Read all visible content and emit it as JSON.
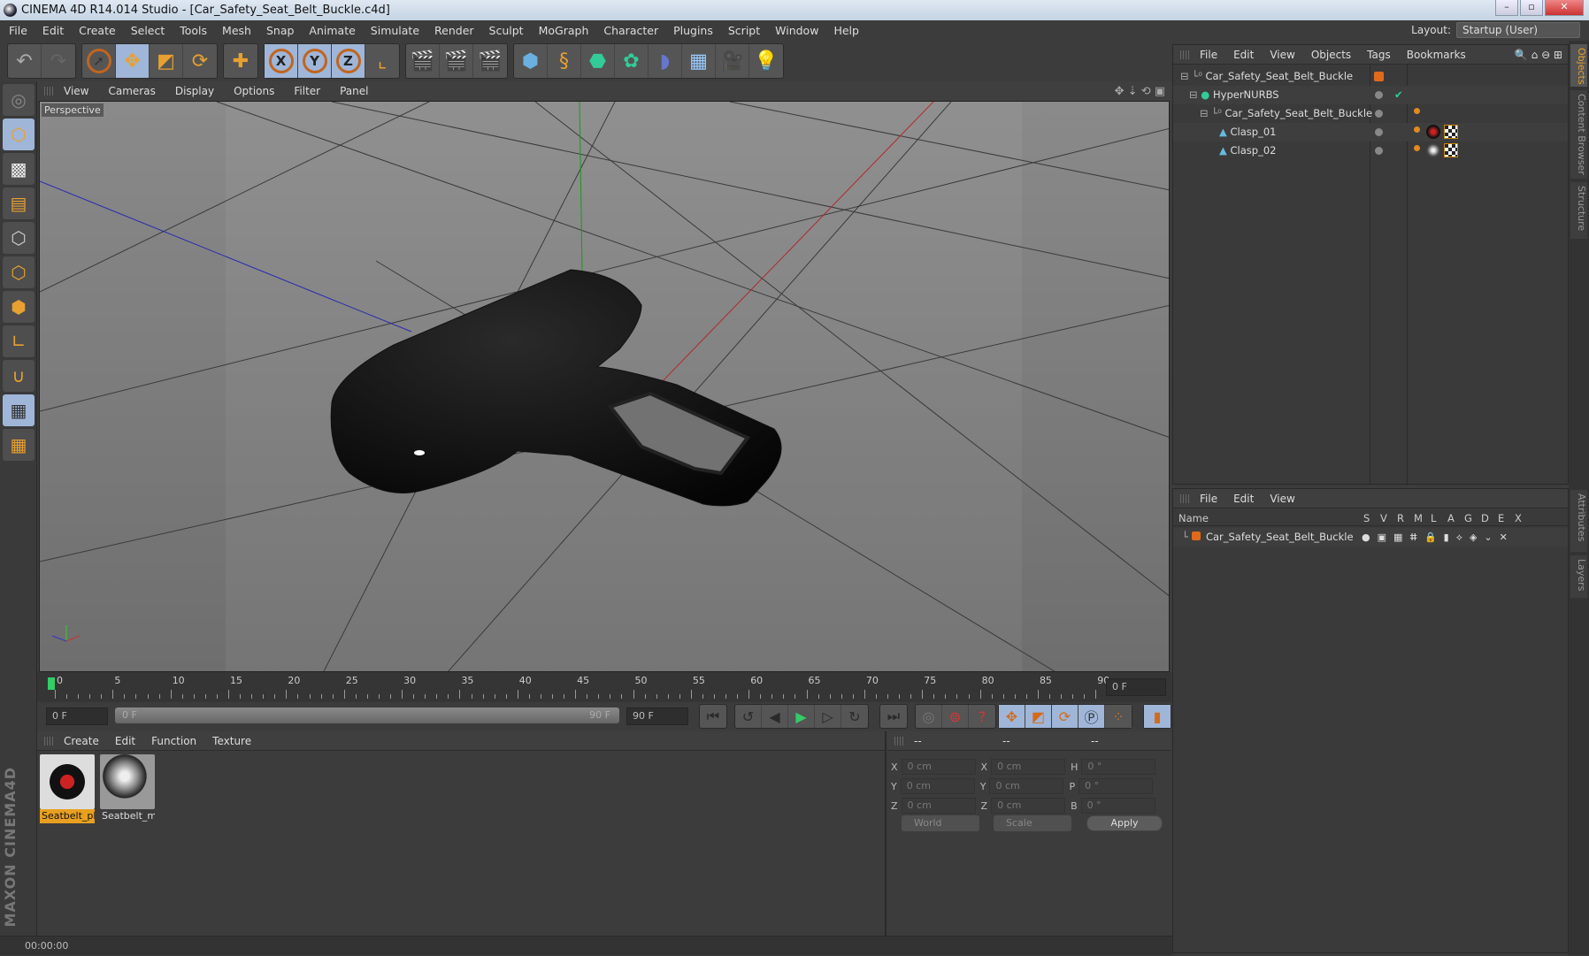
{
  "window": {
    "title": "CINEMA 4D R14.014 Studio - [Car_Safety_Seat_Belt_Buckle.c4d]",
    "minimize": "–",
    "maximize": "▫",
    "close": "✕"
  },
  "menu": [
    "File",
    "Edit",
    "Create",
    "Select",
    "Tools",
    "Mesh",
    "Snap",
    "Animate",
    "Simulate",
    "Render",
    "Sculpt",
    "MoGraph",
    "Character",
    "Plugins",
    "Script",
    "Window",
    "Help"
  ],
  "layout": {
    "label": "Layout:",
    "value": "Startup (User)"
  },
  "viewport": {
    "menu": [
      "View",
      "Cameras",
      "Display",
      "Options",
      "Filter",
      "Panel"
    ],
    "label": "Perspective"
  },
  "timeline": {
    "ticks": [
      0,
      5,
      10,
      15,
      20,
      25,
      30,
      35,
      40,
      45,
      50,
      55,
      60,
      65,
      70,
      75,
      80,
      85,
      90
    ],
    "current_frame": "0 F",
    "start_field": "0 F",
    "range_start": "0 F",
    "range_end": "90 F",
    "end_field": "90 F"
  },
  "materials": {
    "menu": [
      "Create",
      "Edit",
      "Function",
      "Texture"
    ],
    "items": [
      {
        "name": "Seatbelt_pl",
        "selected": true
      },
      {
        "name": "Seatbelt_m",
        "selected": false
      }
    ]
  },
  "coords": {
    "headers": [
      "--",
      "--",
      "--"
    ],
    "rows": [
      {
        "a": "X",
        "av": "0 cm",
        "b": "X",
        "bv": "0 cm",
        "c": "H",
        "cv": "0 °"
      },
      {
        "a": "Y",
        "av": "0 cm",
        "b": "Y",
        "bv": "0 cm",
        "c": "P",
        "cv": "0 °"
      },
      {
        "a": "Z",
        "av": "0 cm",
        "b": "Z",
        "bv": "0 cm",
        "c": "B",
        "cv": "0 °"
      }
    ],
    "space": "World",
    "mode": "Scale",
    "apply": "Apply"
  },
  "status": {
    "time": "00:00:00"
  },
  "object_manager": {
    "menu": [
      "File",
      "Edit",
      "View",
      "Objects",
      "Tags",
      "Bookmarks"
    ],
    "objects": [
      {
        "name": "Car_Safety_Seat_Belt_Buckle",
        "type": "null"
      },
      {
        "name": "HyperNURBS",
        "type": "hypernurbs"
      },
      {
        "name": "Car_Safety_Seat_Belt_Buckle",
        "type": "null"
      },
      {
        "name": "Clasp_01",
        "type": "polygon"
      },
      {
        "name": "Clasp_02",
        "type": "polygon"
      }
    ]
  },
  "layer_manager": {
    "menu": [
      "File",
      "Edit",
      "View"
    ],
    "columns": [
      "Name",
      "S",
      "V",
      "R",
      "M",
      "L",
      "A",
      "G",
      "D",
      "E",
      "X"
    ],
    "layers": [
      {
        "name": "Car_Safety_Seat_Belt_Buckle",
        "color": "#e06a1c"
      }
    ]
  },
  "side_tabs": [
    "Objects",
    "Content Browser",
    "Structure",
    "Attributes",
    "Layers"
  ],
  "branding": "MAXON CINEMA 4D",
  "colors": {
    "accent": "#e8a030",
    "active_tool": "#9fb6d8",
    "layer": "#e06a1c"
  }
}
